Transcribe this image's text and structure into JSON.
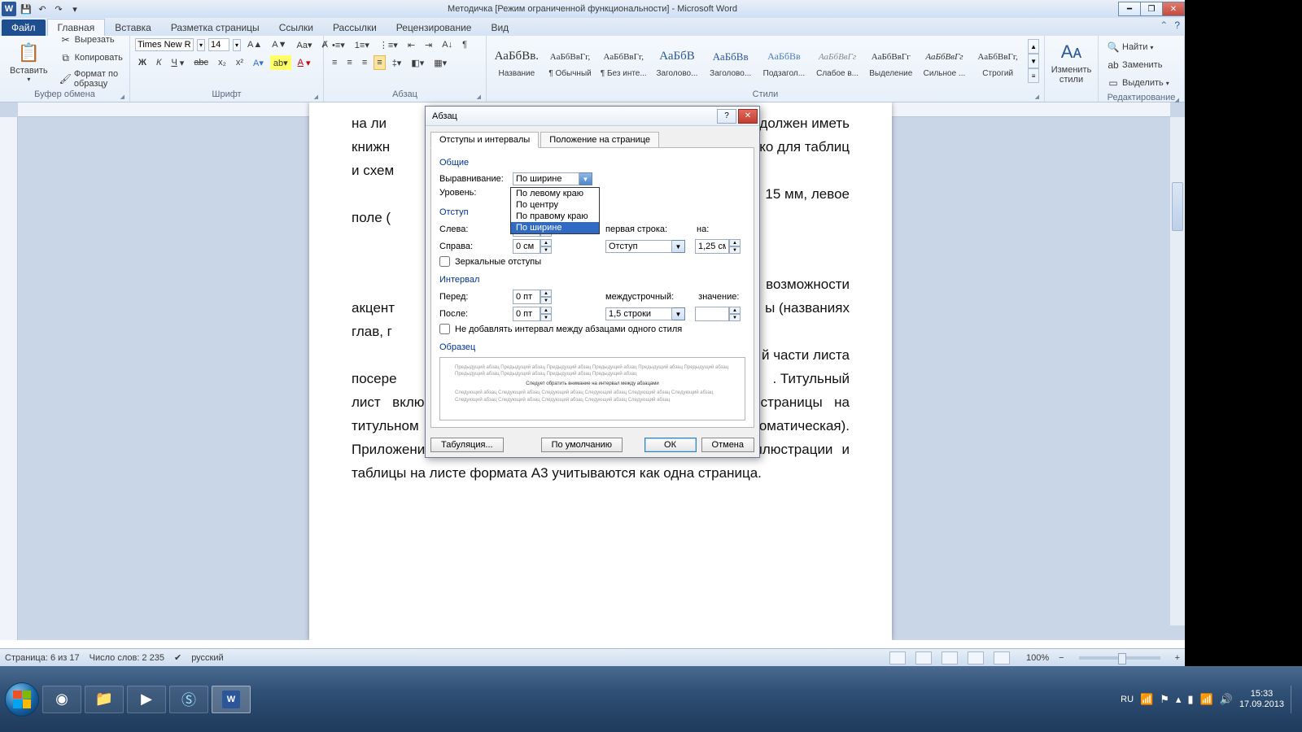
{
  "titlebar": {
    "doc_title": "Методичка [Режим ограниченной функциональности] - Microsoft Word"
  },
  "tabs": {
    "file": "Файл",
    "home": "Главная",
    "insert": "Вставка",
    "layout": "Разметка страницы",
    "refs": "Ссылки",
    "mail": "Рассылки",
    "review": "Рецензирование",
    "view": "Вид"
  },
  "ribbon": {
    "clipboard": {
      "name": "Буфер обмена",
      "paste": "Вставить",
      "cut": "Вырезать",
      "copy": "Копировать",
      "painter": "Формат по образцу"
    },
    "font": {
      "name": "Шрифт",
      "family": "Times New Ro",
      "size": "14"
    },
    "paragraph": {
      "name": "Абзац"
    },
    "styles": {
      "name": "Стили",
      "items": [
        {
          "prev": "АаБбВв.",
          "lbl": "Название"
        },
        {
          "prev": "АаБбВвГг,",
          "lbl": "¶ Обычный"
        },
        {
          "prev": "АаБбВвГг,",
          "lbl": "¶ Без инте..."
        },
        {
          "prev": "АаБбВ",
          "lbl": "Заголово..."
        },
        {
          "prev": "АаБбВв",
          "lbl": "Заголово..."
        },
        {
          "prev": "АаБбВв",
          "lbl": "Подзагол..."
        },
        {
          "prev": "АаБбВвГг",
          "lbl": "Слабое в..."
        },
        {
          "prev": "АаБбВвГг",
          "lbl": "Выделение"
        },
        {
          "prev": "АаБбВвГг",
          "lbl": "Сильное ..."
        },
        {
          "prev": "АаБбВвГг,",
          "lbl": "Строгий"
        }
      ],
      "change": "Изменить стили"
    },
    "editing": {
      "name": "Редактирование",
      "find": "Найти",
      "replace": "Заменить",
      "select": "Выделить"
    }
  },
  "document": {
    "p1_a": "на ли",
    "p1_b": "должен иметь",
    "p2_a": "книжн",
    "p2_b": "ко для таблиц",
    "p3": "и схем",
    "p4_b": "15 мм, левое",
    "p5": "поле (",
    "p6_b": "возможности",
    "p7_a": "акцент",
    "p7_b": "ы (названиях",
    "p8": "глав, г",
    "p9_b": "й части листа",
    "p10_a": "посере",
    "p10_b": ". Титульный",
    "p11": "лист включается в общую нумерацию страниц. Номер страницы на титульном листе не проставляется (нумерация страниц - автоматическая). Приложения включаются в общую нумерацию страниц. Иллюстрации и таблицы на листе формата А3 учитываются как одна страница."
  },
  "dialog": {
    "title": "Абзац",
    "tab1": "Отступы и интервалы",
    "tab2": "Положение на странице",
    "sec_general": "Общие",
    "lbl_align": "Выравнивание:",
    "align_value": "По ширине",
    "align_options": [
      "По левому краю",
      "По центру",
      "По правому краю",
      "По ширине"
    ],
    "align_selected_index": 3,
    "lbl_level": "Уровень:",
    "sec_indent": "Отступ",
    "lbl_left": "Слева:",
    "left_val": "0 см",
    "lbl_right": "Справа:",
    "right_val": "0 см",
    "lbl_firstline": "первая строка:",
    "firstline_val": "Отступ",
    "lbl_by": "на:",
    "by_val": "1,25 см",
    "chk_mirror": "Зеркальные отступы",
    "sec_spacing": "Интервал",
    "lbl_before": "Перед:",
    "before_val": "0 пт",
    "lbl_after": "После:",
    "after_val": "0 пт",
    "lbl_linesp": "междустрочный:",
    "linesp_val": "1,5 строки",
    "lbl_linesp_at": "значение:",
    "linesp_at_val": "",
    "chk_nosamespace": "Не добавлять интервал между абзацами одного стиля",
    "sec_preview": "Образец",
    "preview_grey": "Предыдущий абзац Предыдущий абзац Предыдущий абзац Предыдущий абзац Предыдущий абзац Предыдущий абзац Предыдущий абзац Предыдущий абзац Предыдущий абзац Предыдущий абзац",
    "preview_emph": "Следует обратить внимание на интервал между абзацами",
    "preview_grey2": "Следующий абзац Следующий абзац Следующий абзац Следующий абзац Следующий абзац Следующий абзац Следующий абзац Следующий абзац Следующий абзац Следующий абзац Следующий абзац",
    "btn_tabs": "Табуляция...",
    "btn_default": "По умолчанию",
    "btn_ok": "ОК",
    "btn_cancel": "Отмена"
  },
  "statusbar": {
    "page": "Страница: 6 из 17",
    "words": "Число слов: 2 235",
    "lang": "русский",
    "zoom": "100%"
  },
  "taskbar": {
    "lang": "RU",
    "time": "15:33",
    "date": "17.09.2013"
  }
}
